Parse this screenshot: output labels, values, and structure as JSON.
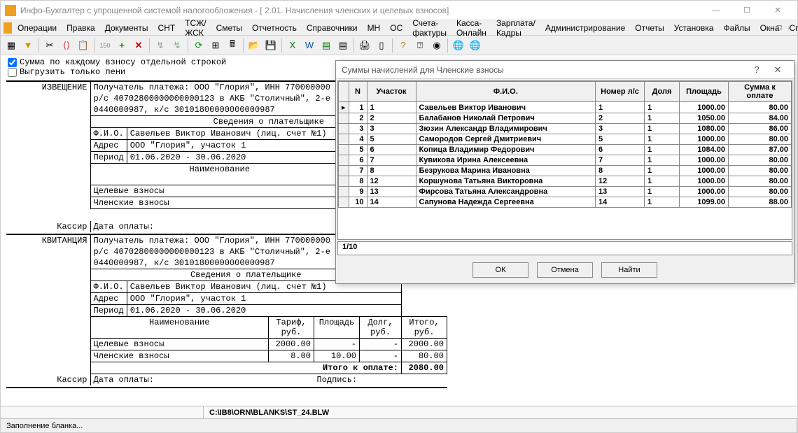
{
  "window": {
    "title": "Инфо-Бухгалтер с упрощенной системой налогообложения - [ 2.01. Начисления членских и целевых взносов]"
  },
  "menu": [
    "Операции",
    "Правка",
    "Документы",
    "СНТ",
    "ТСЖ/ЖСК",
    "Сметы",
    "Отчетность",
    "Справочники",
    "МН",
    "ОС",
    "Счета-фактуры",
    "Касса-Онлайн",
    "Зарплата/Кадры",
    "Администрирование",
    "Отчеты",
    "Установка",
    "Файлы",
    "Окна",
    "Справка"
  ],
  "checks": {
    "sum_each": "Сумма по каждому взносу отдельной строкой",
    "only_peni": "Выгрузить только пени"
  },
  "doc": {
    "izv": "ИЗВЕЩЕНИЕ",
    "kvit": "КВИТАНЦИЯ",
    "kassir": "Кассир",
    "payee1": "Получатель платежа: ООО \"Глория\", ИНН 770000000",
    "payee2": "р/с 40702800000000000123 в АКБ \"Столичный\", 2-е",
    "payee3": "0440000987, к/с 30101800000000000987",
    "payer_head": "Сведения о плательщике",
    "fio_l": "Ф.И.О.",
    "fio_v": "Савельев Виктор Иванович (лиц. счет №1)",
    "adr_l": "Адрес",
    "adr_v": "ООО \"Глория\", участок 1",
    "per_l": "Период",
    "per_v": "01.06.2020 - 30.06.2020",
    "col_name": "Наименование",
    "col_tarif": "Тариф, руб.",
    "col_plosh": "Площадь",
    "col_dolg": "Долг, руб.",
    "col_itogo": "Итого, руб.",
    "row_cel": "Целевые взносы",
    "row_chl": "Членские взносы",
    "val_2000": "2000.00",
    "val_8": "8.00",
    "val_10": "10.00",
    "val_dash": "-",
    "val_80": "80.00",
    "val_2080": "2080.00",
    "itogo_k": "Итого к оплате:",
    "itogo_l": "Итого",
    "data_opl": "Дата оплаты:",
    "podpis": "Подпись:"
  },
  "modal": {
    "title": "Суммы начислений для Членские взносы",
    "cols": [
      "N",
      "Участок",
      "Ф.И.О.",
      "Номер л/с",
      "Доля",
      "Площадь",
      "Сумма к оплате"
    ],
    "rows": [
      {
        "n": "1",
        "u": "1",
        "fio": "Савельев Виктор Иванович",
        "ls": "1",
        "d": "1",
        "p": "1000.00",
        "s": "80.00"
      },
      {
        "n": "2",
        "u": "2",
        "fio": "Балабанов Николай Петрович",
        "ls": "2",
        "d": "1",
        "p": "1050.00",
        "s": "84.00"
      },
      {
        "n": "3",
        "u": "3",
        "fio": "Зюзин Александр Владимирович",
        "ls": "3",
        "d": "1",
        "p": "1080.00",
        "s": "86.00"
      },
      {
        "n": "4",
        "u": "5",
        "fio": "Самородов Сергей Дмитриевич",
        "ls": "5",
        "d": "1",
        "p": "1000.00",
        "s": "80.00"
      },
      {
        "n": "5",
        "u": "6",
        "fio": "Копица Владимир Федорович",
        "ls": "6",
        "d": "1",
        "p": "1084.00",
        "s": "87.00"
      },
      {
        "n": "6",
        "u": "7",
        "fio": "Кувикова Ирина Алексеевна",
        "ls": "7",
        "d": "1",
        "p": "1000.00",
        "s": "80.00"
      },
      {
        "n": "7",
        "u": "8",
        "fio": "Безрукова Марина Ивановна",
        "ls": "8",
        "d": "1",
        "p": "1000.00",
        "s": "80.00"
      },
      {
        "n": "8",
        "u": "12",
        "fio": "Коршунова Татьяна Викторовна",
        "ls": "12",
        "d": "1",
        "p": "1000.00",
        "s": "80.00"
      },
      {
        "n": "9",
        "u": "13",
        "fio": "Фирсова Татьяна Александровна",
        "ls": "13",
        "d": "1",
        "p": "1000.00",
        "s": "80.00"
      },
      {
        "n": "10",
        "u": "14",
        "fio": "Сапунова Надежда Сергеевна",
        "ls": "14",
        "d": "1",
        "p": "1099.00",
        "s": "88.00"
      }
    ],
    "footer": "1/10",
    "ok": "ОК",
    "cancel": "Отмена",
    "find": "Найти"
  },
  "path": "C:\\IB8\\ORN\\BLANKS\\ST_24.BLW",
  "status": "Заполнение бланка..."
}
